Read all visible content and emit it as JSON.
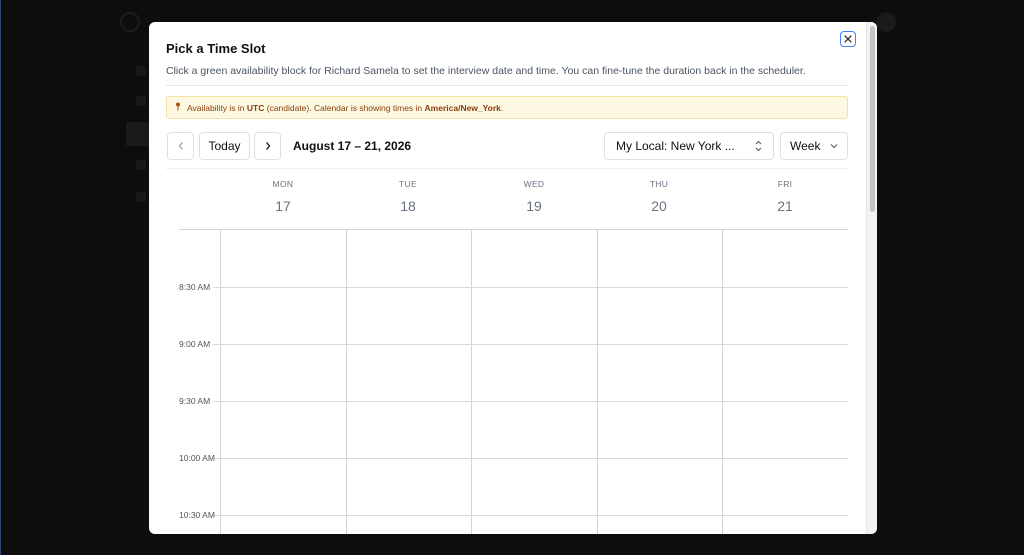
{
  "dialog": {
    "title": "Pick a Time Slot",
    "description": "Click a green availability block for Richard Samela to set the interview date and time. You can fine-tune the duration back in the scheduler.",
    "close_icon": "close-icon"
  },
  "banner": {
    "icon": "pin-icon",
    "prefix": "Availability is in ",
    "candidate_tz": "UTC",
    "middle": " (candidate). Calendar is showing times in ",
    "calendar_tz": "America/New_York",
    "suffix": "."
  },
  "toolbar": {
    "prev_icon": "chevron-left-icon",
    "today_label": "Today",
    "next_icon": "chevron-right-icon",
    "date_range": "August 17 – 21, 2026",
    "timezone_value": "My Local: New York ...",
    "view_value": "Week"
  },
  "days": [
    {
      "dow": "MON",
      "date": "17"
    },
    {
      "dow": "TUE",
      "date": "18"
    },
    {
      "dow": "WED",
      "date": "19"
    },
    {
      "dow": "THU",
      "date": "20"
    },
    {
      "dow": "FRI",
      "date": "21"
    }
  ],
  "times": [
    "8:30 AM",
    "9:00 AM",
    "9:30 AM",
    "10:00 AM",
    "10:30 AM"
  ]
}
